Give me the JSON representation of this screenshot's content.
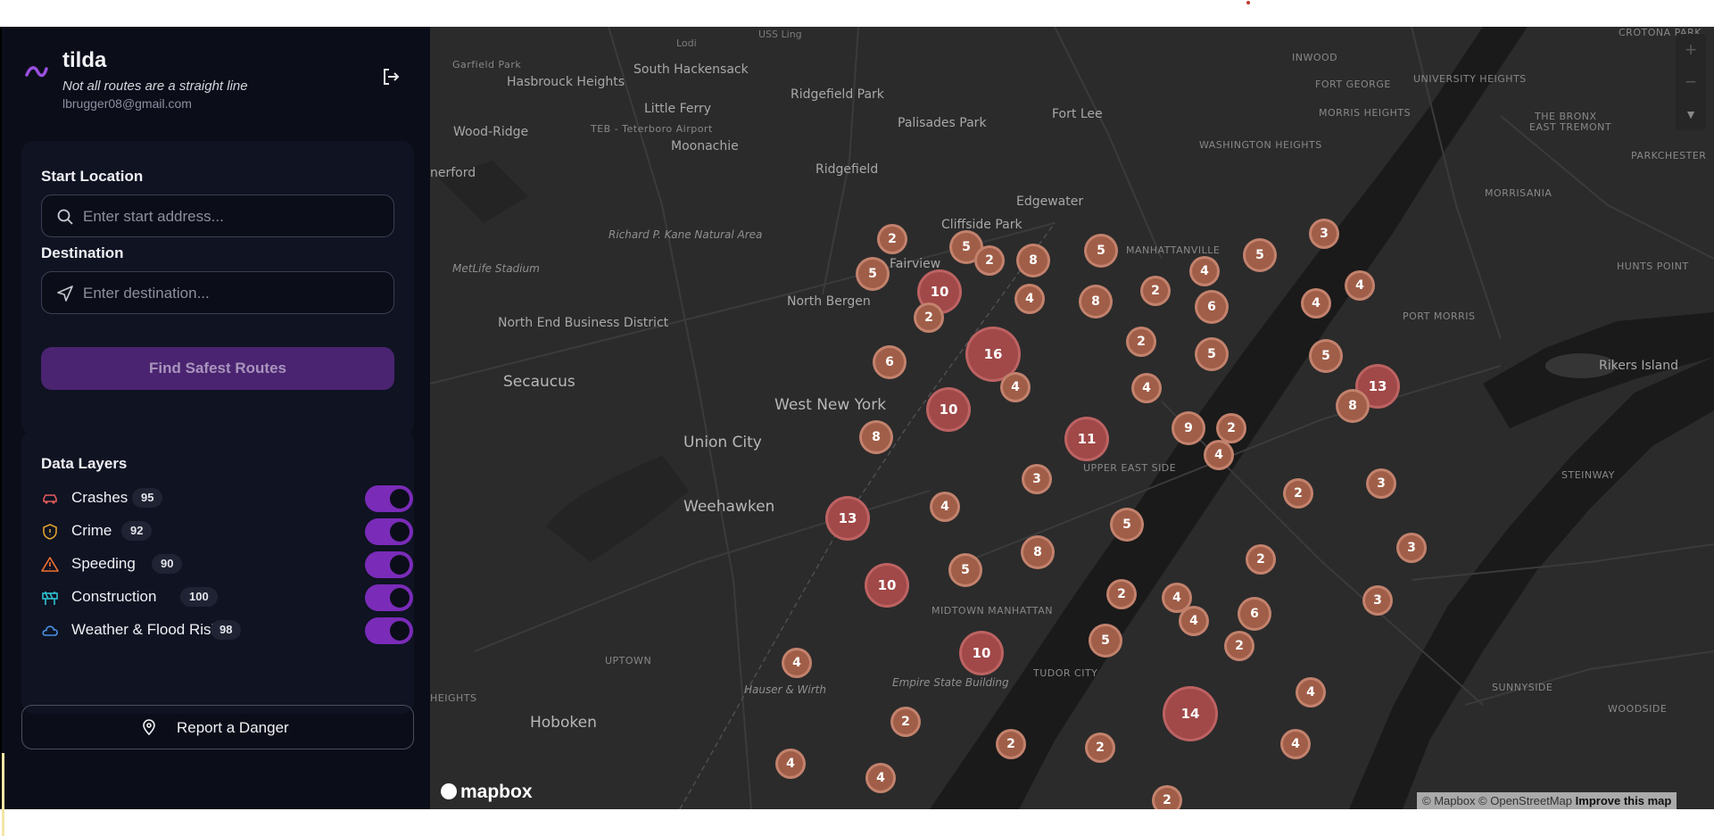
{
  "app": {
    "name": "tilda",
    "tagline": "Not all routes are a straight line",
    "user_email": "lbrugger08@gmail.com",
    "accent_color": "#7a2bb8"
  },
  "route_panel": {
    "start_label": "Start Location",
    "start_placeholder": "Enter start address...",
    "start_value": "",
    "destination_label": "Destination",
    "destination_placeholder": "Enter destination...",
    "destination_value": "",
    "find_button": "Find Safest Routes"
  },
  "layers": {
    "title": "Data Layers",
    "items": [
      {
        "label": "Crashes",
        "count": "95",
        "icon": "car-icon",
        "color": "#e05a5a",
        "enabled": true
      },
      {
        "label": "Crime",
        "count": "92",
        "icon": "shield-icon",
        "color": "#e0a030",
        "enabled": true
      },
      {
        "label": "Speeding",
        "count": "90",
        "icon": "warning-icon",
        "color": "#f07030",
        "enabled": true
      },
      {
        "label": "Construction",
        "count": "100",
        "icon": "construction-icon",
        "color": "#30c0d0",
        "enabled": true
      },
      {
        "label": "Weather & Flood Risk",
        "count": "98",
        "icon": "cloud-icon",
        "color": "#4a90e2",
        "enabled": true
      }
    ]
  },
  "report_button": "Report a Danger",
  "map": {
    "attribution": "© Mapbox © OpenStreetMap",
    "improve": "Improve this map",
    "logo_text": "mapbox",
    "zoom_in": "+",
    "zoom_out": "−",
    "labels": [
      "Garfield Park",
      "Hasbrouck Heights",
      "South Hackensack",
      "Little Ferry",
      "Ridgefield Park",
      "Palisades Park",
      "Fort Lee",
      "Wood-Ridge",
      "TEB - Teterboro Airport",
      "Moonachie",
      "Ridgefield",
      "Edgewater",
      "Cliffside Park",
      "Fairview",
      "North Bergen",
      "Richard P. Kane Natural Area",
      "MetLife Stadium",
      "North End Business District",
      "Secaucus",
      "West New York",
      "Union City",
      "Weehawken",
      "Hoboken",
      "UPTOWN",
      "HEIGHTS",
      "Hauser & Wirth",
      "MIDTOWN MANHATTAN",
      "Empire State Building",
      "TUDOR CITY",
      "UPPER EAST SIDE",
      "MANHATTANVILLE",
      "WASHINGTON HEIGHTS",
      "INWOOD",
      "FORT GEORGE",
      "UNIVERSITY HEIGHTS",
      "MORRIS HEIGHTS",
      "EAST TREMONT",
      "THE BRONX",
      "CROTONA PARK",
      "PARKCHESTER",
      "MORRISANIA",
      "HUNTS POINT",
      "PORT MORRIS",
      "Rikers Island",
      "STEINWAY",
      "SUNNYSIDE",
      "WOODSIDE",
      "Lodi",
      "USS Ling",
      "nerford"
    ],
    "clusters": [
      {
        "n": "2"
      },
      {
        "n": "5"
      },
      {
        "n": "5"
      },
      {
        "n": "10"
      },
      {
        "n": "2"
      },
      {
        "n": "8"
      },
      {
        "n": "2"
      },
      {
        "n": "4"
      },
      {
        "n": "5"
      },
      {
        "n": "8"
      },
      {
        "n": "2"
      },
      {
        "n": "4"
      },
      {
        "n": "6"
      },
      {
        "n": "5"
      },
      {
        "n": "4"
      },
      {
        "n": "3"
      },
      {
        "n": "4"
      },
      {
        "n": "6"
      },
      {
        "n": "16"
      },
      {
        "n": "2"
      },
      {
        "n": "5"
      },
      {
        "n": "5"
      },
      {
        "n": "4"
      },
      {
        "n": "4"
      },
      {
        "n": "13"
      },
      {
        "n": "10"
      },
      {
        "n": "8"
      },
      {
        "n": "11"
      },
      {
        "n": "9"
      },
      {
        "n": "2"
      },
      {
        "n": "8"
      },
      {
        "n": "4"
      },
      {
        "n": "3"
      },
      {
        "n": "3"
      },
      {
        "n": "4"
      },
      {
        "n": "13"
      },
      {
        "n": "2"
      },
      {
        "n": "2"
      },
      {
        "n": "5"
      },
      {
        "n": "8"
      },
      {
        "n": "3"
      },
      {
        "n": "3"
      },
      {
        "n": "5"
      },
      {
        "n": "10"
      },
      {
        "n": "6"
      },
      {
        "n": "2"
      },
      {
        "n": "4"
      },
      {
        "n": "5"
      },
      {
        "n": "4"
      },
      {
        "n": "10"
      },
      {
        "n": "2"
      },
      {
        "n": "4"
      },
      {
        "n": "14"
      },
      {
        "n": "4"
      },
      {
        "n": "2"
      },
      {
        "n": "2"
      },
      {
        "n": "2"
      },
      {
        "n": "4"
      },
      {
        "n": "4"
      },
      {
        "n": "4"
      },
      {
        "n": "2"
      }
    ]
  }
}
